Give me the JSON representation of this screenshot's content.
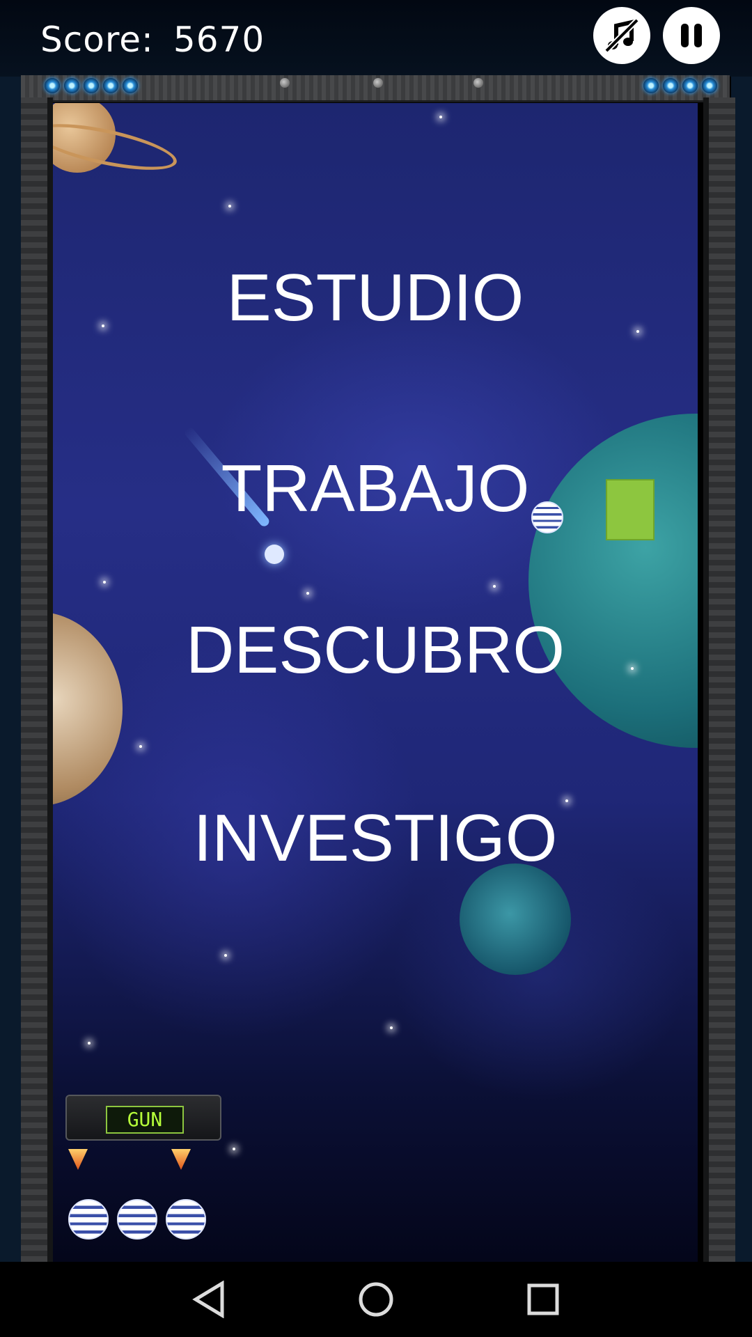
{
  "hud": {
    "score_label": "Score:",
    "score_value": "5670"
  },
  "words": [
    "ESTUDIO",
    "TRABAJO",
    "DESCUBRO",
    "INVESTIGO"
  ],
  "ship": {
    "label": "GUN"
  },
  "lives_count": 3,
  "colors": {
    "accent_block": "#8dc63f",
    "background": "#1f2777"
  },
  "navigation": [
    "back-icon",
    "home-icon",
    "recents-icon"
  ]
}
